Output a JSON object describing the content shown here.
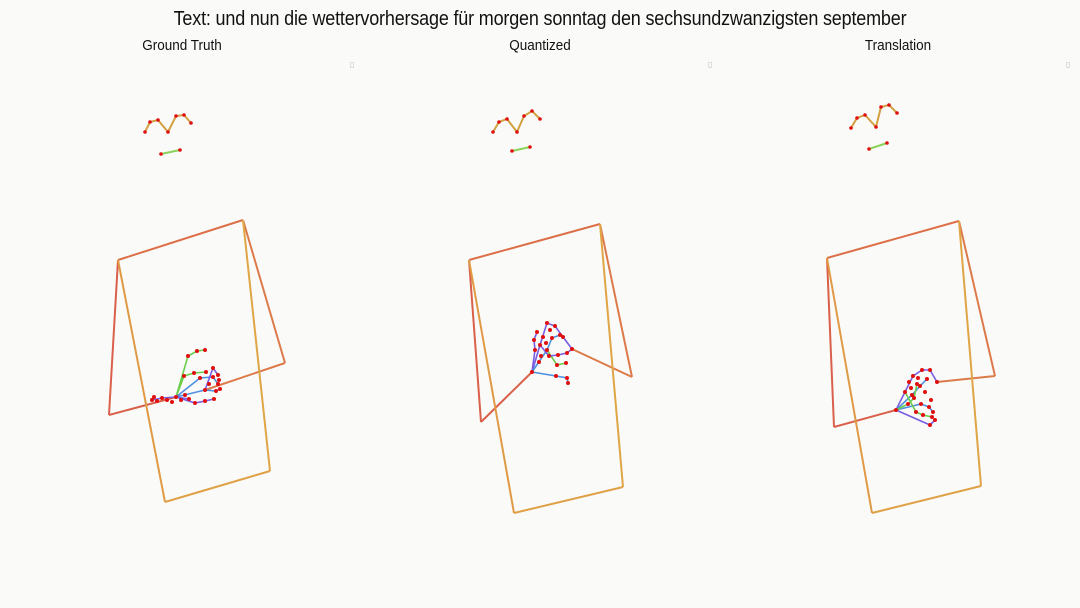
{
  "title": "Text: und nun die wettervorhersage für morgen sonntag den sechsundzwanzigsten september",
  "panels": [
    {
      "label": "Ground Truth"
    },
    {
      "label": "Quantized"
    },
    {
      "label": "Translation"
    }
  ],
  "marker_glyph": "▯",
  "colors": {
    "background": "#fafbf9",
    "body_line_1": "#d9604a",
    "body_line_2": "#e09a45",
    "face": "#d2a040",
    "face_green": "#8ad45a",
    "hand_purple": "#7a5ce0",
    "hand_blue": "#4f8fe0",
    "hand_green": "#6acd4a",
    "joint": "#e01010"
  }
}
